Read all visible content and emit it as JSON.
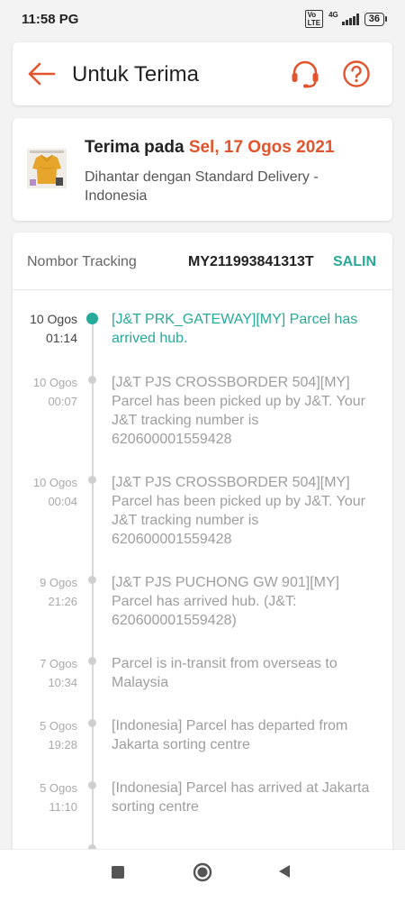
{
  "status_bar": {
    "time": "11:58 PG",
    "network": "4G",
    "volte": "Vo LTE",
    "battery": "36"
  },
  "header": {
    "title": "Untuk Terima",
    "icons": [
      "back-arrow-icon",
      "headset-icon",
      "help-icon"
    ],
    "accent_color": "#e2542d"
  },
  "delivery": {
    "prefix": "Terima pada",
    "date": "Sel, 17 Ogos 2021",
    "subtitle": "Dihantar dengan Standard Delivery - Indonesia"
  },
  "tracking": {
    "label": "Nombor Tracking",
    "number": "MY211993841313T",
    "copy_label": "SALIN",
    "accent_color": "#26aa99",
    "events": [
      {
        "date": "10 Ogos",
        "time": "01:14",
        "text": "[J&T PRK_GATEWAY][MY] Parcel has arrived hub.",
        "active": true
      },
      {
        "date": "10 Ogos",
        "time": "00:07",
        "text": "[J&T PJS CROSSBORDER 504][MY] Parcel has been picked up by J&T. Your J&T tracking number is 620600001559428",
        "active": false
      },
      {
        "date": "10 Ogos",
        "time": "00:04",
        "text": "[J&T PJS CROSSBORDER 504][MY] Parcel has been picked up by J&T. Your J&T tracking number is 620600001559428",
        "active": false
      },
      {
        "date": "9 Ogos",
        "time": "21:26",
        "text": "[J&T PJS PUCHONG GW 901][MY] Parcel has arrived hub. (J&T: 620600001559428)",
        "active": false
      },
      {
        "date": "7 Ogos",
        "time": "10:34",
        "text": "Parcel is in-transit from overseas to Malaysia",
        "active": false
      },
      {
        "date": "5 Ogos",
        "time": "19:28",
        "text": "[Indonesia] Parcel has departed from Jakarta sorting centre",
        "active": false
      },
      {
        "date": "5 Ogos",
        "time": "11:10",
        "text": "[Indonesia] Parcel has arrived at Jakarta sorting centre",
        "active": false
      }
    ]
  },
  "nav": {
    "icons": [
      "recent-apps-icon",
      "home-icon",
      "back-icon"
    ]
  }
}
